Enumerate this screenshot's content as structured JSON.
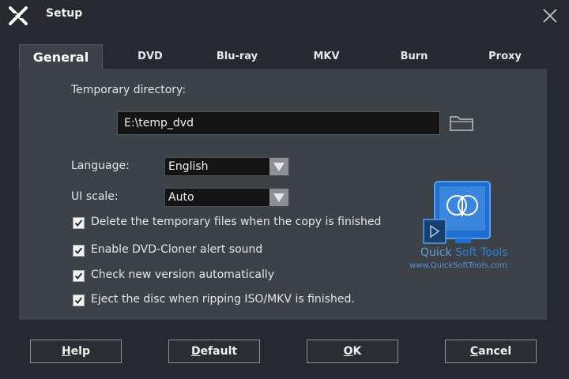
{
  "window": {
    "title": "Setup"
  },
  "tabs": [
    {
      "label": "General"
    },
    {
      "label": "DVD"
    },
    {
      "label": "Blu-ray"
    },
    {
      "label": "MKV"
    },
    {
      "label": "Burn"
    },
    {
      "label": "Proxy"
    }
  ],
  "general": {
    "temp_dir_label": "Temporary directory:",
    "temp_dir_value": "E:\\temp_dvd",
    "language_label": "Language:",
    "language_value": "English",
    "ui_scale_label": "UI scale:",
    "ui_scale_value": "Auto",
    "options": [
      {
        "label": "Delete the temporary files when the copy is finished",
        "checked": true
      },
      {
        "label": "Enable DVD-Cloner alert sound",
        "checked": true
      },
      {
        "label": "Check new version automatically",
        "checked": true
      },
      {
        "label": "Eject the disc when ripping ISO/MKV is finished.",
        "checked": true
      }
    ]
  },
  "watermark": {
    "name_part1": "Quick",
    "name_part2": "Soft Tools",
    "url": "www.QuickSoftTools.com"
  },
  "buttons": {
    "help_first": "H",
    "help_rest": "elp",
    "default_first": "D",
    "default_rest": "efault",
    "ok_first": "O",
    "ok_rest": "K",
    "cancel_first": "C",
    "cancel_rest": "ancel"
  },
  "icons": {
    "app": "x-logo-icon",
    "close": "close-icon",
    "folder": "folder-icon",
    "dropdown": "chevron-down-icon"
  },
  "colors": {
    "background": "#262a30",
    "panel": "#3d4148",
    "input": "#141414",
    "accent_blue": "#2e7fd6"
  }
}
